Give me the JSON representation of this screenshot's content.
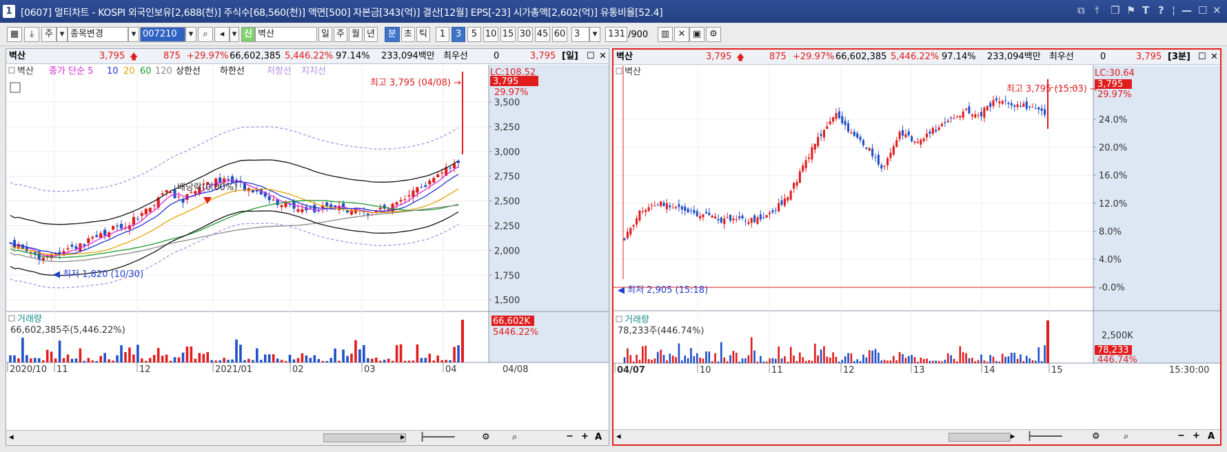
{
  "window": {
    "number": "1",
    "title": "[0607] 멀티차트 - KOSPI 외국인보유[2,688(천)] 주식수[68,560(천)] 액면[500] 자본금[343(억)] 결산[12월] EPS[-23] 시가총액[2,602(억)] 유통비율[52.4]"
  },
  "toolbar": {
    "market": "주",
    "stock_change": "종목변경",
    "code": "007210",
    "badge": "신",
    "name": "벽산",
    "periods": [
      "일",
      "주",
      "월",
      "년",
      "분",
      "초",
      "틱"
    ],
    "active_period": "분",
    "intervals": [
      "1",
      "3",
      "5",
      "10",
      "15",
      "30",
      "45",
      "60"
    ],
    "active_interval": "3",
    "interval_value": "3",
    "count": "131",
    "count_total": "/900"
  },
  "left": {
    "name": "벽산",
    "price": "3,795",
    "change": "875",
    "change_pct": "+29.97%",
    "volume": "66,602,385",
    "vol_ratio": "5,446.22%",
    "strength": "97.14%",
    "amount": "233,094백만",
    "bid_label": "최우선",
    "bid_qty": "0",
    "bid_price": "3,795",
    "period_tag": "[일]",
    "legend_name": "벽산",
    "legend_items": [
      "종가 단순 5",
      "10",
      "20",
      "60",
      "120",
      "상한선",
      "하한선",
      "저항선",
      "지지선"
    ],
    "lc_label": "LC:108.52",
    "price_box": "3,795",
    "price_pct": "29.97%",
    "high_label": "최고 3,795 (04/08)",
    "low_label": "최저 1,820 (10/30)",
    "dividend_label": "배당락(0.00%)",
    "y_ticks": [
      "3,500",
      "3,250",
      "3,000",
      "2,750",
      "2,500",
      "2,250",
      "2,000",
      "1,750",
      "1,500"
    ],
    "volume_title": "거래량",
    "volume_value": "66,602,385주(5,446.22%)",
    "volume_box": "66,602K",
    "volume_pct": "5446.22%",
    "x_labels": [
      "2020/10",
      "11",
      "12",
      "2021/01",
      "02",
      "03",
      "04"
    ],
    "x_right": "04/08"
  },
  "right": {
    "name": "벽산",
    "price": "3,795",
    "change": "875",
    "change_pct": "+29.97%",
    "volume": "66,602,385",
    "vol_ratio": "5,446.22%",
    "strength": "97.14%",
    "amount": "233,094백만",
    "bid_label": "최우선",
    "bid_qty": "0",
    "bid_price": "3,795",
    "period_tag": "[3분]",
    "legend_name": "벽산",
    "lc_label": "LC:30.64",
    "price_box": "3,795",
    "price_pct": "29.97%",
    "high_label": "최고 3,795 (15:03)",
    "low_label": "최저 2,905 (15:18)",
    "y_ticks": [
      "24.0%",
      "20.0%",
      "16.0%",
      "12.0%",
      "8.0%",
      "4.0%",
      "-0.0%"
    ],
    "volume_title": "거래량",
    "volume_value": "78,233주(446.74%)",
    "volume_tick": "2,500K",
    "volume_box": "78,233",
    "volume_pct": "446.74%",
    "x_labels": [
      "04/07",
      "10",
      "11",
      "12",
      "13",
      "14",
      "15"
    ],
    "x_right": "15:30:00"
  },
  "colors": {
    "up": "#e01c1c",
    "down": "#1f4fc8",
    "ma5": "#d82ad8",
    "ma10": "#2233cc",
    "ma20": "#e8a000",
    "ma60": "#1a9a2a",
    "ma120": "#888888",
    "bands": "#b48be8"
  }
}
